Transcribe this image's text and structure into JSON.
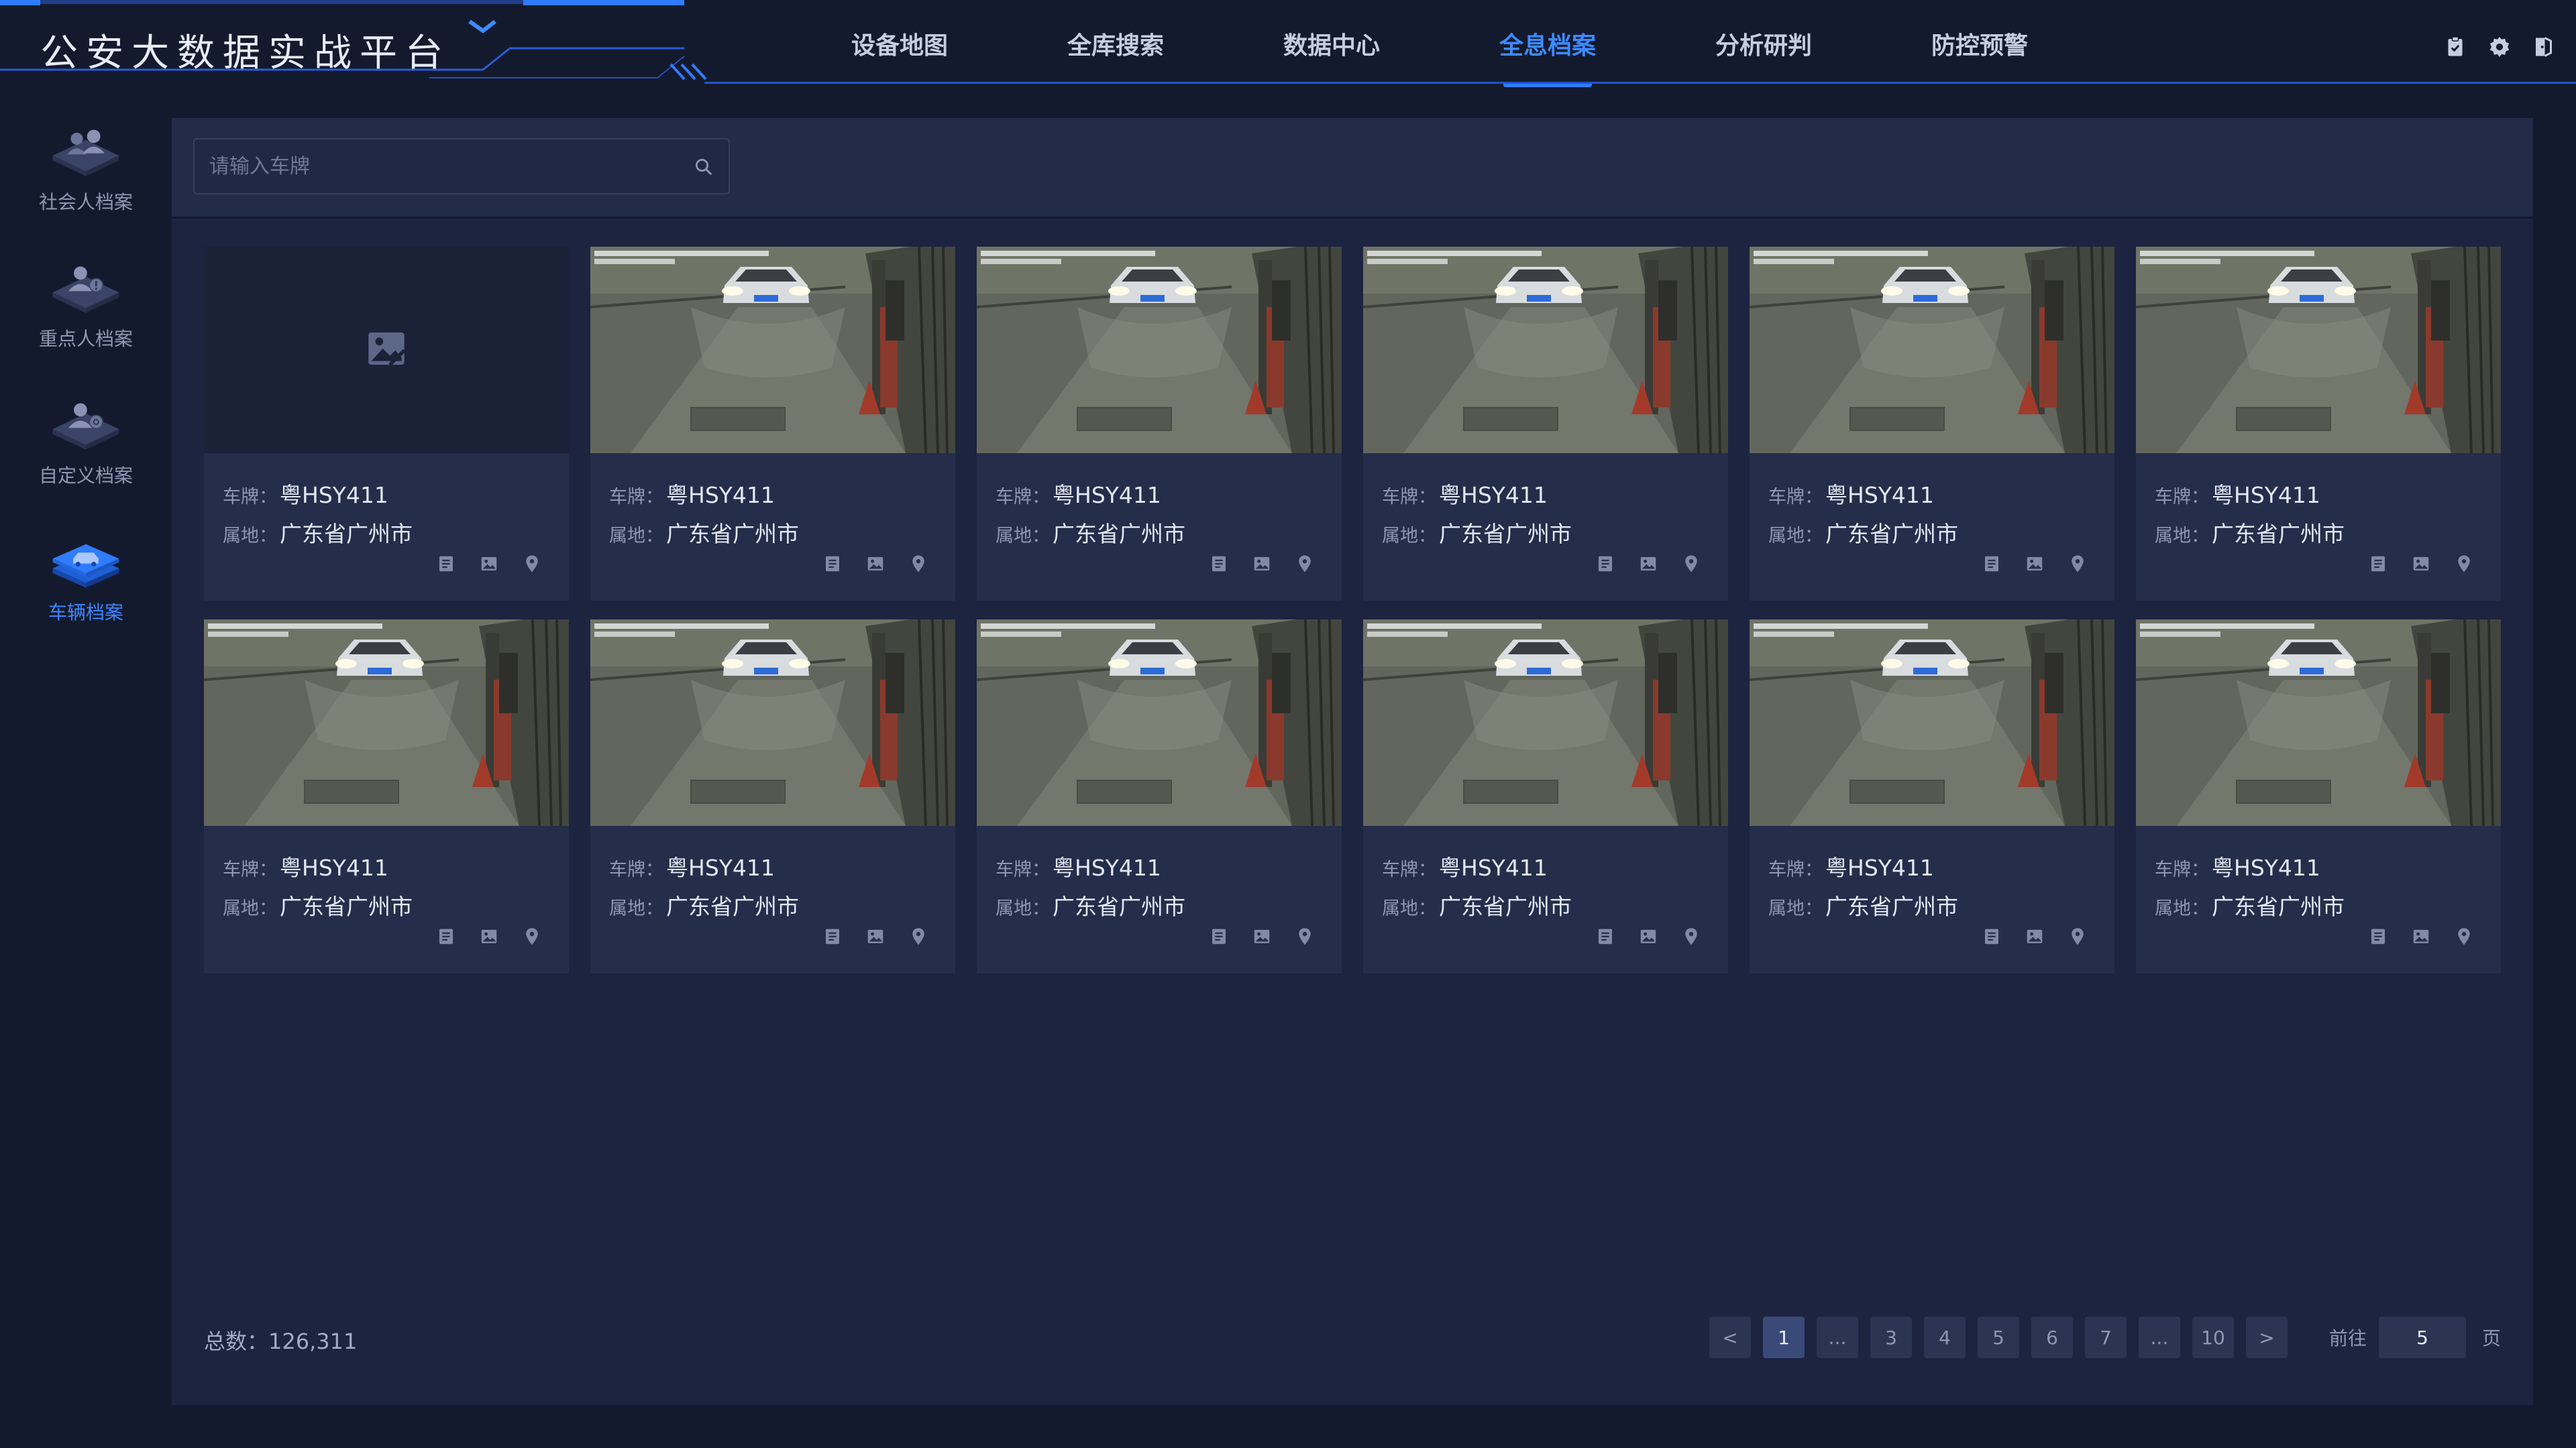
{
  "app": {
    "title": "公安大数据实战平台"
  },
  "nav": {
    "items": [
      {
        "label": "设备地图"
      },
      {
        "label": "全库搜索"
      },
      {
        "label": "数据中心"
      },
      {
        "label": "全息档案",
        "active": true
      },
      {
        "label": "分析研判"
      },
      {
        "label": "防控预警"
      }
    ]
  },
  "header_icons": [
    "clipboard-icon",
    "gear-icon",
    "logout-icon"
  ],
  "sidebar": {
    "items": [
      {
        "label": "社会人档案",
        "icon": "social-person-icon"
      },
      {
        "label": "重点人档案",
        "icon": "key-person-icon"
      },
      {
        "label": "自定义档案",
        "icon": "custom-file-icon"
      },
      {
        "label": "车辆档案",
        "icon": "vehicle-file-icon",
        "active": true
      }
    ]
  },
  "search": {
    "placeholder": "请输入车牌",
    "value": ""
  },
  "card_labels": {
    "plate": "车牌：",
    "location": "属地："
  },
  "cards": [
    {
      "plate": "粤HSY411",
      "location": "广东省广州市",
      "has_image": false
    },
    {
      "plate": "粤HSY411",
      "location": "广东省广州市",
      "has_image": true
    },
    {
      "plate": "粤HSY411",
      "location": "广东省广州市",
      "has_image": true
    },
    {
      "plate": "粤HSY411",
      "location": "广东省广州市",
      "has_image": true
    },
    {
      "plate": "粤HSY411",
      "location": "广东省广州市",
      "has_image": true
    },
    {
      "plate": "粤HSY411",
      "location": "广东省广州市",
      "has_image": true
    },
    {
      "plate": "粤HSY411",
      "location": "广东省广州市",
      "has_image": true
    },
    {
      "plate": "粤HSY411",
      "location": "广东省广州市",
      "has_image": true
    },
    {
      "plate": "粤HSY411",
      "location": "广东省广州市",
      "has_image": true
    },
    {
      "plate": "粤HSY411",
      "location": "广东省广州市",
      "has_image": true
    },
    {
      "plate": "粤HSY411",
      "location": "广东省广州市",
      "has_image": true
    },
    {
      "plate": "粤HSY411",
      "location": "广东省广州市",
      "has_image": true
    }
  ],
  "card_actions": [
    "document-icon",
    "image-icon",
    "location-pin-icon"
  ],
  "footer": {
    "total_label": "总数：",
    "total_value": "126,311",
    "pages": [
      "1",
      "...",
      "3",
      "4",
      "5",
      "6",
      "7",
      "...",
      "10"
    ],
    "current_page": "1",
    "prev": "<",
    "next": ">",
    "goto_label": "前往",
    "goto_value": "5",
    "page_unit": "页"
  },
  "colors": {
    "accent": "#2f7cff",
    "background": "#141a2e",
    "panel": "#1c2440",
    "card": "#242d4a"
  }
}
